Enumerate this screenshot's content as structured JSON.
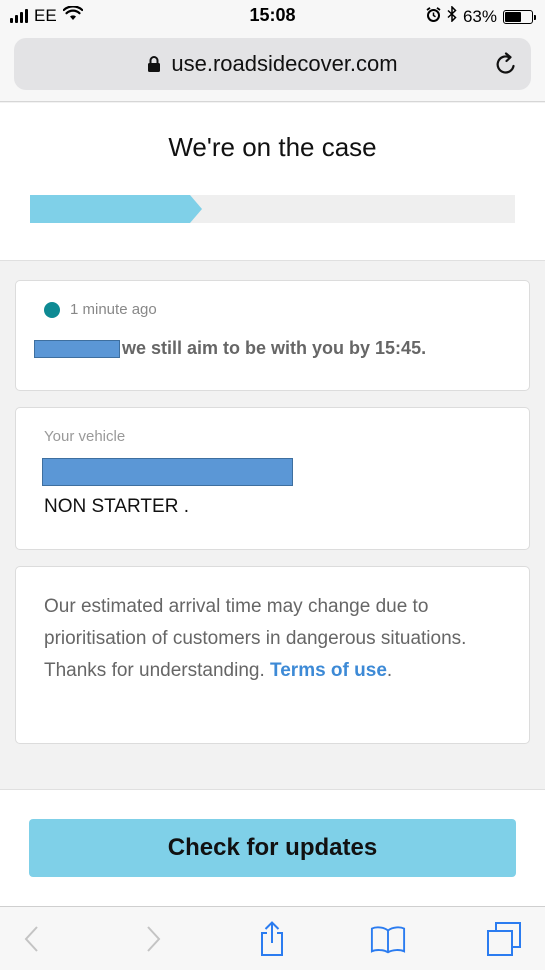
{
  "status_bar": {
    "carrier": "EE",
    "time": "15:08",
    "battery": "63%",
    "battery_level": 0.63,
    "icons": [
      "signal-icon",
      "wifi-icon",
      "alarm-icon",
      "bluetooth-icon",
      "battery-icon"
    ]
  },
  "url_bar": {
    "url": "use.roadsidecover.com",
    "icons": [
      "lock-icon",
      "reload-icon"
    ]
  },
  "header": {
    "title": "We're on the case",
    "progress": 0.33
  },
  "update_card": {
    "time_ago": "1 minute ago",
    "message": "we still aim to be with you by 15:45."
  },
  "vehicle_card": {
    "label": "Your vehicle",
    "status": "NON STARTER ."
  },
  "notice_card": {
    "text": "Our estimated arrival time may change due to prioritisation of customers in dangerous situations. Thanks for understanding.",
    "link_text": "Terms of use",
    "trailing": "."
  },
  "actions": {
    "check_updates_label": "Check for updates"
  },
  "toolbar": {
    "icons": [
      "back-icon",
      "forward-icon",
      "share-icon",
      "bookmarks-icon",
      "tabs-icon"
    ]
  },
  "colors": {
    "accent": "#7fd0e8",
    "link": "#3d8ad6",
    "status_dot": "#0e8a93"
  }
}
